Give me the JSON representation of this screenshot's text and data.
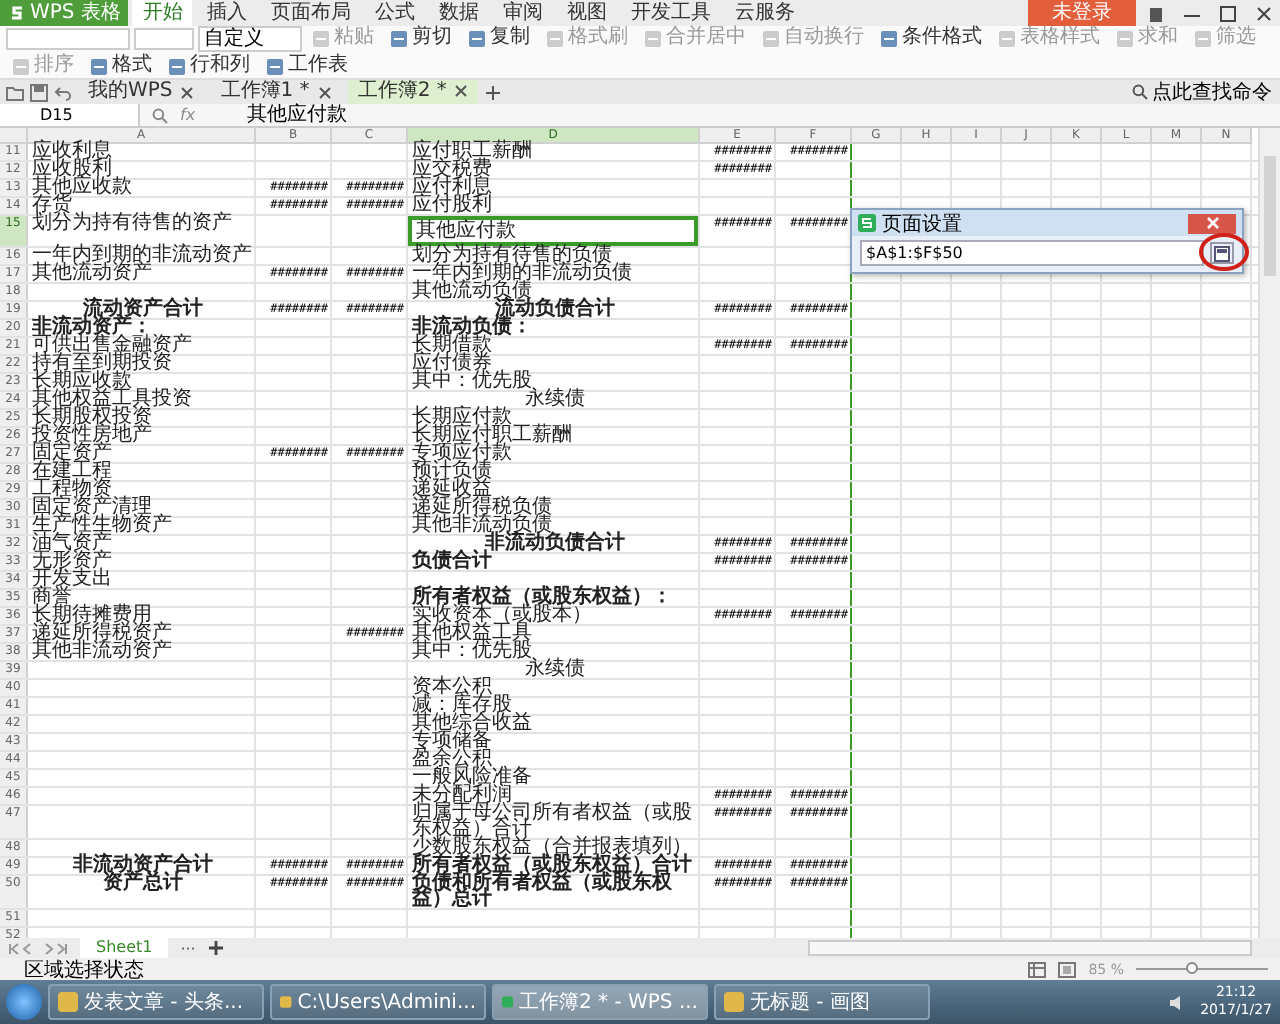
{
  "app": {
    "name": "WPS 表格"
  },
  "menu_tabs": [
    {
      "label": "开始",
      "selected": true
    },
    {
      "label": "插入",
      "selected": false
    },
    {
      "label": "页面布局",
      "selected": false
    },
    {
      "label": "公式",
      "selected": false
    },
    {
      "label": "数据",
      "selected": false
    },
    {
      "label": "审阅",
      "selected": false
    },
    {
      "label": "视图",
      "selected": false
    },
    {
      "label": "开发工具",
      "selected": false
    },
    {
      "label": "云服务",
      "selected": false
    }
  ],
  "login_button": "未登录",
  "ribbon": {
    "number_format": "自定义",
    "buttons": [
      {
        "label": "粘贴",
        "disabled": true
      },
      {
        "label": "剪切",
        "disabled": false
      },
      {
        "label": "复制",
        "disabled": false
      },
      {
        "label": "格式刷",
        "disabled": true
      },
      {
        "label": "合并居中",
        "disabled": true
      },
      {
        "label": "自动换行",
        "disabled": true
      },
      {
        "label": "条件格式",
        "disabled": false
      },
      {
        "label": "表格样式",
        "disabled": true
      },
      {
        "label": "求和",
        "disabled": true
      },
      {
        "label": "筛选",
        "disabled": true
      },
      {
        "label": "排序",
        "disabled": true
      },
      {
        "label": "格式",
        "disabled": false
      },
      {
        "label": "行和列",
        "disabled": false
      },
      {
        "label": "工作表",
        "disabled": false
      }
    ]
  },
  "doc_tabs": [
    {
      "label": "我的WPS",
      "selected": false
    },
    {
      "label": "工作簿1 *",
      "selected": false
    },
    {
      "label": "工作簿2 *",
      "selected": true
    }
  ],
  "command_search": "点此查找命令",
  "formula_bar": {
    "name_box": "D15",
    "fx_label": "fx",
    "content": "其他应付款"
  },
  "sheet": {
    "columns": [
      {
        "label": "A",
        "selected": false
      },
      {
        "label": "B",
        "selected": false
      },
      {
        "label": "C",
        "selected": false
      },
      {
        "label": "D",
        "selected": true
      },
      {
        "label": "E",
        "selected": false
      },
      {
        "label": "F",
        "selected": false
      },
      {
        "label": "G",
        "selected": false
      },
      {
        "label": "H",
        "selected": false
      },
      {
        "label": "I",
        "selected": false
      },
      {
        "label": "J",
        "selected": false
      },
      {
        "label": "K",
        "selected": false
      },
      {
        "label": "L",
        "selected": false
      },
      {
        "label": "M",
        "selected": false
      },
      {
        "label": "N",
        "selected": false
      }
    ],
    "rows": [
      {
        "number": "11",
        "selected": false,
        "cells": [
          "应收利息",
          "",
          "",
          "应付职工薪酬",
          "########",
          "########"
        ]
      },
      {
        "number": "12",
        "selected": false,
        "cells": [
          "应收股利",
          "",
          "",
          "应交税费",
          "########",
          ""
        ]
      },
      {
        "number": "13",
        "selected": false,
        "cells": [
          "其他应收款",
          "########",
          "########",
          "应付利息",
          "",
          ""
        ]
      },
      {
        "number": "14",
        "selected": false,
        "cells": [
          "存货",
          "########",
          "########",
          "应付股利",
          "",
          ""
        ]
      },
      {
        "number": "15",
        "selected": true,
        "cells": [
          "划分为持有待售的资产",
          "",
          "",
          "其他应付款",
          "########",
          "########"
        ]
      },
      {
        "number": "16",
        "selected": false,
        "cells": [
          "一年内到期的非流动资产",
          "",
          "",
          "划分为持有待售的负债",
          "",
          ""
        ]
      },
      {
        "number": "17",
        "selected": false,
        "cells": [
          "其他流动资产",
          "########",
          "########",
          "一年内到期的非流动负债",
          "",
          ""
        ]
      },
      {
        "number": "18",
        "selected": false,
        "cells": [
          "",
          "",
          "",
          "其他流动负债",
          "",
          ""
        ]
      },
      {
        "number": "19",
        "selected": false,
        "cells": [
          {
            "text": "流动资产合计",
            "kind": "total"
          },
          "########",
          "########",
          {
            "text": "流动负债合计",
            "kind": "total"
          },
          "########",
          "########"
        ]
      },
      {
        "number": "20",
        "selected": false,
        "cells": [
          {
            "text": "非流动资产：",
            "kind": "heading"
          },
          "",
          "",
          {
            "text": "非流动负债：",
            "kind": "heading"
          },
          "",
          ""
        ]
      },
      {
        "number": "21",
        "selected": false,
        "cells": [
          "可供出售金融资产",
          "",
          "",
          "长期借款",
          "########",
          "########"
        ]
      },
      {
        "number": "22",
        "selected": false,
        "cells": [
          "持有至到期投资",
          "",
          "",
          "应付债券",
          "",
          ""
        ]
      },
      {
        "number": "23",
        "selected": false,
        "cells": [
          "长期应收款",
          "",
          "",
          "其中：优先股",
          "",
          ""
        ]
      },
      {
        "number": "24",
        "selected": false,
        "cells": [
          "其他权益工具投资",
          "",
          "",
          {
            "text": "永续债",
            "kind": "sub"
          },
          "",
          ""
        ]
      },
      {
        "number": "25",
        "selected": false,
        "cells": [
          "长期股权投资",
          "",
          "",
          "长期应付款",
          "",
          ""
        ]
      },
      {
        "number": "26",
        "selected": false,
        "cells": [
          "投资性房地产",
          "",
          "",
          "长期应付职工薪酬",
          "",
          ""
        ]
      },
      {
        "number": "27",
        "selected": false,
        "cells": [
          "固定资产",
          "########",
          "########",
          "专项应付款",
          "",
          ""
        ]
      },
      {
        "number": "28",
        "selected": false,
        "cells": [
          "在建工程",
          "",
          "",
          "预计负债",
          "",
          ""
        ]
      },
      {
        "number": "29",
        "selected": false,
        "cells": [
          "工程物资",
          "",
          "",
          "递延收益",
          "",
          ""
        ]
      },
      {
        "number": "30",
        "selected": false,
        "cells": [
          "固定资产清理",
          "",
          "",
          "递延所得税负债",
          "",
          ""
        ]
      },
      {
        "number": "31",
        "selected": false,
        "cells": [
          "生产性生物资产",
          "",
          "",
          "其他非流动负债",
          "",
          ""
        ]
      },
      {
        "number": "32",
        "selected": false,
        "cells": [
          "油气资产",
          "",
          "",
          {
            "text": "非流动负债合计",
            "kind": "total"
          },
          "########",
          "########"
        ]
      },
      {
        "number": "33",
        "selected": false,
        "cells": [
          "无形资产",
          "",
          "",
          {
            "text": "负债合计",
            "kind": "heading"
          },
          "########",
          "########"
        ]
      },
      {
        "number": "34",
        "selected": false,
        "cells": [
          "开发支出",
          "",
          "",
          "",
          "",
          ""
        ]
      },
      {
        "number": "35",
        "selected": false,
        "cells": [
          "商誉",
          "",
          "",
          {
            "text": "所有者权益（或股东权益）：",
            "kind": "heading"
          },
          "",
          ""
        ]
      },
      {
        "number": "36",
        "selected": false,
        "cells": [
          "长期待摊费用",
          "",
          "",
          "实收资本（或股本）",
          "########",
          "########"
        ]
      },
      {
        "number": "37",
        "selected": false,
        "cells": [
          "递延所得税资产",
          "",
          "########",
          "其他权益工具",
          "",
          ""
        ]
      },
      {
        "number": "38",
        "selected": false,
        "cells": [
          "其他非流动资产",
          "",
          "",
          "其中：优先股",
          "",
          ""
        ]
      },
      {
        "number": "39",
        "selected": false,
        "cells": [
          "",
          "",
          "",
          {
            "text": "永续债",
            "kind": "sub"
          },
          "",
          ""
        ]
      },
      {
        "number": "40",
        "selected": false,
        "cells": [
          "",
          "",
          "",
          "资本公积",
          "",
          ""
        ]
      },
      {
        "number": "41",
        "selected": false,
        "cells": [
          "",
          "",
          "",
          "减：库存股",
          "",
          ""
        ]
      },
      {
        "number": "42",
        "selected": false,
        "cells": [
          "",
          "",
          "",
          "其他综合收益",
          "",
          ""
        ]
      },
      {
        "number": "43",
        "selected": false,
        "cells": [
          "",
          "",
          "",
          "专项储备",
          "",
          ""
        ]
      },
      {
        "number": "44",
        "selected": false,
        "cells": [
          "",
          "",
          "",
          "盈余公积",
          "",
          ""
        ]
      },
      {
        "number": "45",
        "selected": false,
        "cells": [
          "",
          "",
          "",
          "一般风险准备",
          "",
          ""
        ]
      },
      {
        "number": "46",
        "selected": false,
        "cells": [
          "",
          "",
          "",
          "未分配利润",
          "########",
          "########"
        ]
      },
      {
        "number": "47",
        "selected": false,
        "cells": [
          "",
          "",
          "",
          "归属于母公司所有者权益（或股东权益）合计",
          "########",
          "########"
        ]
      },
      {
        "number": "48",
        "selected": false,
        "cells": [
          "",
          "",
          "",
          "少数股东权益（合并报表填列）",
          "",
          ""
        ]
      },
      {
        "number": "49",
        "selected": false,
        "cells": [
          {
            "text": "非流动资产合计",
            "kind": "total"
          },
          "########",
          "########",
          {
            "text": "所有者权益（或股东权益）合计",
            "kind": "heading"
          },
          "########",
          "########"
        ]
      },
      {
        "number": "50",
        "selected": false,
        "cells": [
          {
            "text": "资产总计",
            "kind": "total"
          },
          "########",
          "########",
          {
            "text": "负债和所有者权益（或股东权益）总计",
            "kind": "heading"
          },
          "########",
          "########"
        ]
      },
      {
        "number": "51",
        "selected": false,
        "cells": [
          "",
          "",
          "",
          "",
          "",
          ""
        ]
      },
      {
        "number": "52",
        "selected": false,
        "cells": [
          "",
          "",
          "",
          "",
          "",
          ""
        ]
      }
    ]
  },
  "dialog": {
    "title": "页面设置",
    "value": "$A$1:$F$50"
  },
  "sheet_tabs": [
    {
      "label": "Sheet1",
      "selected": true
    }
  ],
  "sheet_more": "···",
  "status_bar": {
    "text": "区域选择状态",
    "zoom": "85 %",
    "zoom_slider": {
      "level": 0.42
    }
  },
  "taskbar": {
    "items": [
      {
        "label": "发表文章 - 头条...",
        "selected": false
      },
      {
        "label": "C:\\Users\\Admini...",
        "selected": false
      },
      {
        "label": "工作簿2 * - WPS ...",
        "selected": true
      },
      {
        "label": "无标题 - 画图",
        "selected": false
      }
    ],
    "time": "21:12",
    "date": "2017/1/27"
  }
}
